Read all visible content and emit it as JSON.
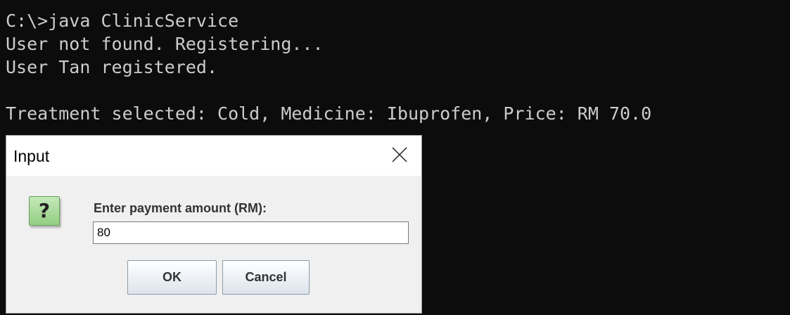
{
  "console": {
    "lines": [
      "C:\\>java ClinicService",
      "User not found. Registering...",
      "User Tan registered.",
      "Treatment selected: Cold, Medicine: Ibuprofen, Price: RM 70.0"
    ]
  },
  "dialog": {
    "title": "Input",
    "icon": "question-icon",
    "icon_glyph": "?",
    "prompt": "Enter payment amount (RM):",
    "input_value": "80",
    "ok_label": "OK",
    "cancel_label": "Cancel"
  },
  "colors": {
    "console_bg": "#0c0c0c",
    "console_text": "#cccccc",
    "dialog_bg": "#f0f0f0",
    "icon_green": "#93cf82"
  }
}
